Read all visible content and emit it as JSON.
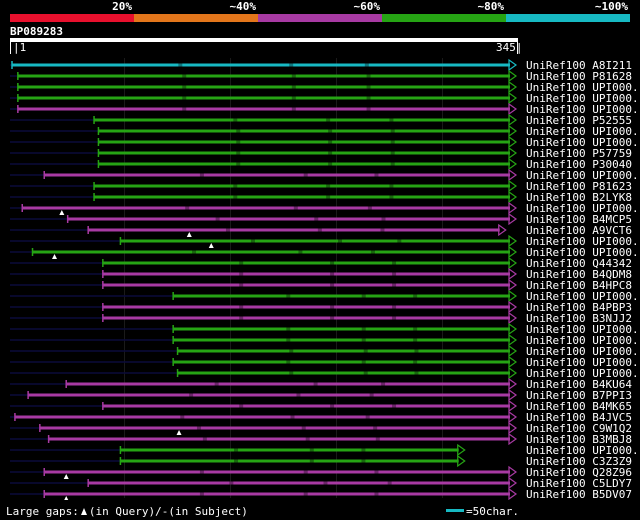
{
  "legend": {
    "labels": [
      "20%",
      "~40%",
      "~60%",
      "~80%",
      "~100%"
    ],
    "colors": [
      "#e8102d",
      "#e3761b",
      "#a83aa3",
      "#26a414",
      "#17b9c3"
    ]
  },
  "query": {
    "id": "BP089283",
    "start": "|1",
    "end": "345|",
    "length": 345
  },
  "footer": {
    "gaps_label": "Large gaps:",
    "in_query": "(in Query)/",
    "in_subject_mark": "-",
    "in_subject": "(in Subject)",
    "scale_label": "=50char."
  },
  "hits": [
    {
      "name": "UniRef100_A8I211",
      "color": "cyan",
      "start": 1,
      "end": 345,
      "lead": 1,
      "gap": null
    },
    {
      "name": "UniRef100_P81628",
      "color": "green",
      "start": 5,
      "end": 345,
      "lead": 1,
      "gap": null
    },
    {
      "name": "UniRef100_UPI000..",
      "color": "green",
      "start": 5,
      "end": 345,
      "lead": 1,
      "gap": null
    },
    {
      "name": "UniRef100_UPI000..",
      "color": "green",
      "start": 5,
      "end": 345,
      "lead": 1,
      "gap": null
    },
    {
      "name": "UniRef100_UPI000..",
      "color": "purple",
      "start": 5,
      "end": 345,
      "lead": 1,
      "gap": null
    },
    {
      "name": "UniRef100_P52555",
      "color": "green",
      "start": 57,
      "end": 345,
      "lead": 1,
      "gap": null
    },
    {
      "name": "UniRef100_UPI000..",
      "color": "green",
      "start": 60,
      "end": 345,
      "lead": 1,
      "gap": null
    },
    {
      "name": "UniRef100_UPI000..",
      "color": "green",
      "start": 60,
      "end": 345,
      "lead": 1,
      "gap": null
    },
    {
      "name": "UniRef100_P57759",
      "color": "green",
      "start": 60,
      "end": 345,
      "lead": 1,
      "gap": null
    },
    {
      "name": "UniRef100_P30040",
      "color": "green",
      "start": 60,
      "end": 345,
      "lead": 1,
      "gap": null
    },
    {
      "name": "UniRef100_UPI000..",
      "color": "purple",
      "start": 23,
      "end": 345,
      "lead": 1,
      "gap": null
    },
    {
      "name": "UniRef100_P81623",
      "color": "green",
      "start": 57,
      "end": 345,
      "lead": 1,
      "gap": null
    },
    {
      "name": "UniRef100_B2LYK8",
      "color": "green",
      "start": 57,
      "end": 345,
      "lead": 1,
      "gap": null
    },
    {
      "name": "UniRef100_UPI000..",
      "color": "purple",
      "start": 8,
      "end": 345,
      "lead": 1,
      "gap": 35
    },
    {
      "name": "UniRef100_B4MCP5",
      "color": "purple",
      "start": 39,
      "end": 345,
      "lead": 1,
      "gap": null
    },
    {
      "name": "UniRef100_A9VCT6",
      "color": "purple",
      "start": 53,
      "end": 338,
      "lead": 1,
      "gap": 122
    },
    {
      "name": "UniRef100_UPI000..",
      "color": "green",
      "start": 75,
      "end": 345,
      "lead": 1,
      "gap": 137
    },
    {
      "name": "UniRef100_UPI000..",
      "color": "green",
      "start": 15,
      "end": 345,
      "lead": 1,
      "gap": 30
    },
    {
      "name": "UniRef100_Q44342",
      "color": "green",
      "start": 63,
      "end": 345,
      "lead": 1,
      "gap": null
    },
    {
      "name": "UniRef100_B4QDM8",
      "color": "purple",
      "start": 63,
      "end": 345,
      "lead": 1,
      "gap": null
    },
    {
      "name": "UniRef100_B4HPC8",
      "color": "purple",
      "start": 63,
      "end": 345,
      "lead": 1,
      "gap": null
    },
    {
      "name": "UniRef100_UPI000..",
      "color": "green",
      "start": 111,
      "end": 345,
      "lead": 1,
      "gap": null
    },
    {
      "name": "UniRef100_B4PBP3",
      "color": "purple",
      "start": 63,
      "end": 345,
      "lead": 1,
      "gap": null
    },
    {
      "name": "UniRef100_B3NJJ2",
      "color": "purple",
      "start": 63,
      "end": 345,
      "lead": 1,
      "gap": null
    },
    {
      "name": "UniRef100_UPI000..",
      "color": "green",
      "start": 111,
      "end": 345,
      "lead": 1,
      "gap": null
    },
    {
      "name": "UniRef100_UPI000..",
      "color": "green",
      "start": 111,
      "end": 345,
      "lead": 1,
      "gap": null
    },
    {
      "name": "UniRef100_UPI000..",
      "color": "green",
      "start": 114,
      "end": 345,
      "lead": 1,
      "gap": null
    },
    {
      "name": "UniRef100_UPI000..",
      "color": "green",
      "start": 111,
      "end": 345,
      "lead": 1,
      "gap": null
    },
    {
      "name": "UniRef100_UPI000..",
      "color": "green",
      "start": 114,
      "end": 345,
      "lead": 1,
      "gap": null
    },
    {
      "name": "UniRef100_B4KU64",
      "color": "purple",
      "start": 38,
      "end": 345,
      "lead": 1,
      "gap": null
    },
    {
      "name": "UniRef100_B7PPI3",
      "color": "purple",
      "start": 12,
      "end": 345,
      "lead": 1,
      "gap": null
    },
    {
      "name": "UniRef100_B4MK65",
      "color": "purple",
      "start": 63,
      "end": 345,
      "lead": 1,
      "gap": null
    },
    {
      "name": "UniRef100_B4JVC5",
      "color": "purple",
      "start": 3,
      "end": 345,
      "lead": 1,
      "gap": null
    },
    {
      "name": "UniRef100_C9W1Q2",
      "color": "purple",
      "start": 20,
      "end": 345,
      "lead": 1,
      "gap": 115
    },
    {
      "name": "UniRef100_B3MBJ8",
      "color": "purple",
      "start": 26,
      "end": 345,
      "lead": 1,
      "gap": null
    },
    {
      "name": "UniRef100_UPI000..",
      "color": "green",
      "start": 75,
      "end": 310,
      "lead": 1,
      "gap": null
    },
    {
      "name": "UniRef100_C3Z3Z9",
      "color": "green",
      "start": 75,
      "end": 310,
      "lead": 1,
      "gap": null
    },
    {
      "name": "UniRef100_Q28Z96",
      "color": "purple",
      "start": 23,
      "end": 345,
      "lead": 1,
      "gap": 38
    },
    {
      "name": "UniRef100_C5LDY7",
      "color": "purple",
      "start": 53,
      "end": 345,
      "lead": 1,
      "gap": null
    },
    {
      "name": "UniRef100_B5DV07",
      "color": "purple",
      "start": 23,
      "end": 345,
      "lead": 1,
      "gap": 38
    }
  ]
}
